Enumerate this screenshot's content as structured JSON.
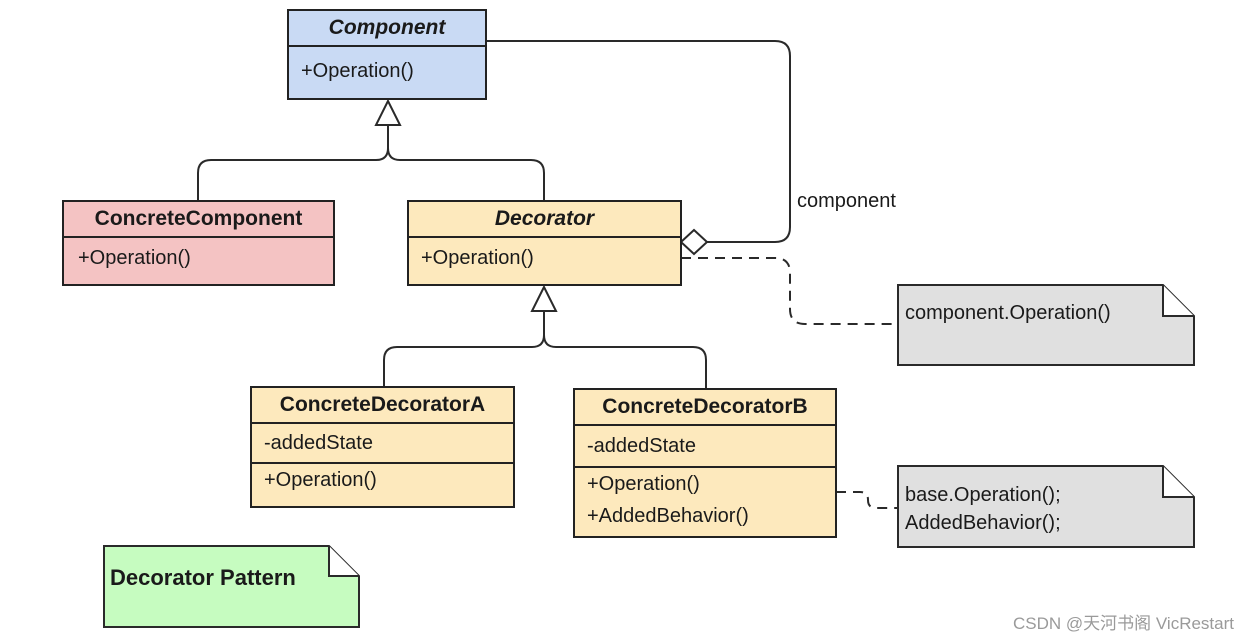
{
  "diagram": {
    "title_note": "Decorator Pattern",
    "classes": {
      "component": {
        "name": "Component",
        "abstract": true,
        "operations": [
          "+Operation()"
        ],
        "fill": "#c9daf4"
      },
      "concrete_component": {
        "name": "ConcreteComponent",
        "abstract": false,
        "operations": [
          "+Operation()"
        ],
        "fill": "#f4c3c3"
      },
      "decorator": {
        "name": "Decorator",
        "abstract": true,
        "operations": [
          "+Operation()"
        ],
        "fill": "#fde9bd"
      },
      "concrete_decorator_a": {
        "name": "ConcreteDecoratorA",
        "abstract": false,
        "attributes": [
          "-addedState"
        ],
        "operations": [
          "+Operation()"
        ],
        "fill": "#fde9bd"
      },
      "concrete_decorator_b": {
        "name": "ConcreteDecoratorB",
        "abstract": false,
        "attributes": [
          "-addedState"
        ],
        "operations": [
          "+Operation()",
          "+AddedBehavior()"
        ],
        "fill": "#fde9bd"
      }
    },
    "relations": [
      {
        "type": "generalization",
        "from": "ConcreteComponent",
        "to": "Component"
      },
      {
        "type": "generalization",
        "from": "Decorator",
        "to": "Component"
      },
      {
        "type": "aggregation",
        "from": "Decorator",
        "to": "Component",
        "label": "component"
      },
      {
        "type": "generalization",
        "from": "ConcreteDecoratorA",
        "to": "Decorator"
      },
      {
        "type": "generalization",
        "from": "ConcreteDecoratorB",
        "to": "Decorator"
      }
    ],
    "aggregation_label": "component",
    "notes": {
      "decorator_note": [
        "component.Operation()"
      ],
      "decorator_b_note": [
        "base.Operation();",
        "AddedBehavior();"
      ]
    },
    "note_fill": "#e0e0e0",
    "title_note_fill": "#c6fcc0"
  },
  "watermark": "CSDN @天河书阁 VicRestart"
}
